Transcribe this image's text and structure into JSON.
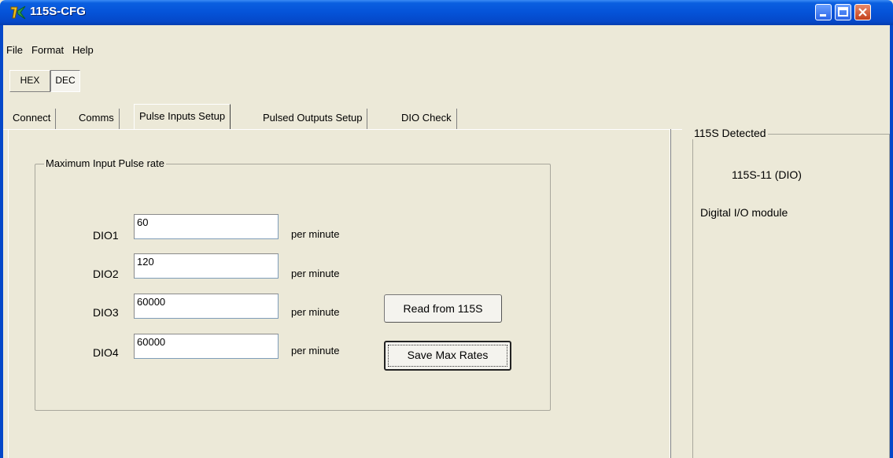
{
  "window": {
    "title": "115S-CFG",
    "title_bar_color": "#0548c9",
    "app_icon": "app-logo-icon"
  },
  "menu": {
    "items": [
      "File",
      "Format",
      "Help"
    ]
  },
  "number_format": {
    "hex_label": "HEX",
    "dec_label": "DEC",
    "selected": "DEC"
  },
  "tabs": [
    {
      "label": "Connect"
    },
    {
      "label": "Comms"
    },
    {
      "label": "Pulse Inputs Setup",
      "active": true
    },
    {
      "label": "Pulsed Outputs Setup"
    },
    {
      "label": "DIO Check"
    }
  ],
  "pulse_group": {
    "caption": "Maximum Input Pulse rate",
    "rows": [
      {
        "label": "DIO1",
        "value": "60",
        "unit": "per minute"
      },
      {
        "label": "DIO2",
        "value": "120",
        "unit": "per minute"
      },
      {
        "label": "DIO3",
        "value": "60000",
        "unit": "per minute"
      },
      {
        "label": "DIO4",
        "value": "60000",
        "unit": "per minute"
      }
    ],
    "read_button": "Read from 115S",
    "save_button": "Save Max Rates"
  },
  "detected": {
    "caption": "115S Detected",
    "model": "115S-11 (DIO)",
    "description": "Digital I/O module"
  }
}
